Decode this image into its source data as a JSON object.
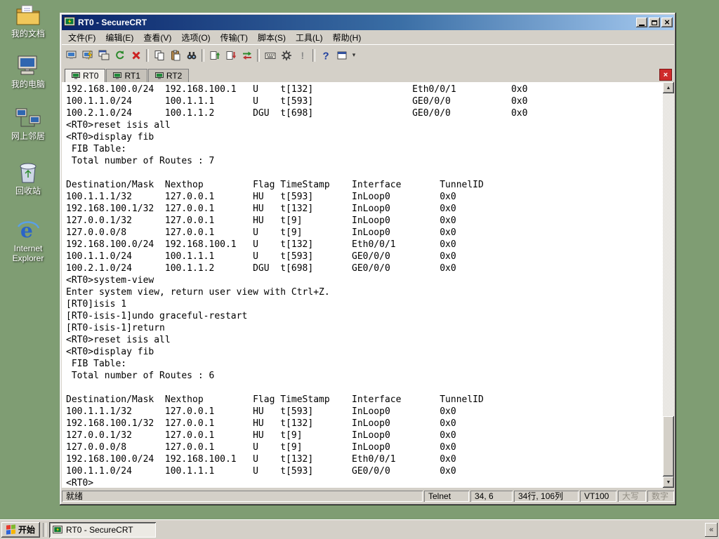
{
  "desktop": {
    "icons": [
      {
        "label": "我的文档"
      },
      {
        "label": "我的电脑"
      },
      {
        "label": "网上邻居"
      },
      {
        "label": "回收站"
      },
      {
        "label": "Internet Explorer"
      }
    ]
  },
  "window": {
    "title": "RT0 - SecureCRT",
    "menus": [
      "文件(F)",
      "编辑(E)",
      "查看(V)",
      "选项(O)",
      "传输(T)",
      "脚本(S)",
      "工具(L)",
      "帮助(H)"
    ],
    "toolbar": {
      "icons": [
        "connect",
        "quick-connect",
        "connect-in-tab",
        "reconnect",
        "disconnect",
        "copy",
        "paste",
        "find",
        "zmodem-upload",
        "zmodem-download",
        "transfer-queue",
        "keymap-editor",
        "session-options",
        "clear-screen",
        "help",
        "new-window",
        "toolbar-overflow"
      ]
    },
    "tabs": [
      {
        "label": "RT0",
        "active": true
      },
      {
        "label": "RT1",
        "active": false
      },
      {
        "label": "RT2",
        "active": false
      }
    ],
    "terminal": {
      "lines": [
        "192.168.100.0/24  192.168.100.1   U    t[132]                  Eth0/0/1          0x0",
        "100.1.1.0/24      100.1.1.1       U    t[593]                  GE0/0/0           0x0",
        "100.2.1.0/24      100.1.1.2       DGU  t[698]                  GE0/0/0           0x0",
        "<RT0>reset isis all",
        "<RT0>display fib",
        " FIB Table:",
        " Total number of Routes : 7",
        "",
        "Destination/Mask  Nexthop         Flag TimeStamp    Interface       TunnelID",
        "100.1.1.1/32      127.0.0.1       HU   t[593]       InLoop0         0x0",
        "192.168.100.1/32  127.0.0.1       HU   t[132]       InLoop0         0x0",
        "127.0.0.1/32      127.0.0.1       HU   t[9]         InLoop0         0x0",
        "127.0.0.0/8       127.0.0.1       U    t[9]         InLoop0         0x0",
        "192.168.100.0/24  192.168.100.1   U    t[132]       Eth0/0/1        0x0",
        "100.1.1.0/24      100.1.1.1       U    t[593]       GE0/0/0         0x0",
        "100.2.1.0/24      100.1.1.2       DGU  t[698]       GE0/0/0         0x0",
        "<RT0>system-view",
        "Enter system view, return user view with Ctrl+Z.",
        "[RT0]isis 1",
        "[RT0-isis-1]undo graceful-restart",
        "[RT0-isis-1]return",
        "<RT0>reset isis all",
        "<RT0>display fib",
        " FIB Table:",
        " Total number of Routes : 6",
        "",
        "Destination/Mask  Nexthop         Flag TimeStamp    Interface       TunnelID",
        "100.1.1.1/32      127.0.0.1       HU   t[593]       InLoop0         0x0",
        "192.168.100.1/32  127.0.0.1       HU   t[132]       InLoop0         0x0",
        "127.0.0.1/32      127.0.0.1       HU   t[9]         InLoop0         0x0",
        "127.0.0.0/8       127.0.0.1       U    t[9]         InLoop0         0x0",
        "192.168.100.0/24  192.168.100.1   U    t[132]       Eth0/0/1        0x0",
        "100.1.1.0/24      100.1.1.1       U    t[593]       GE0/0/0         0x0",
        "<RT0>"
      ]
    },
    "statusbar": {
      "ready": "就绪",
      "protocol": "Telnet",
      "cursor": "34,  6",
      "grid": "34行, 106列",
      "emulation": "VT100",
      "caps": "大写",
      "num": "数字"
    }
  },
  "taskbar": {
    "start": "开始",
    "task": "RT0 - SecureCRT",
    "tray_chevron": "«"
  }
}
